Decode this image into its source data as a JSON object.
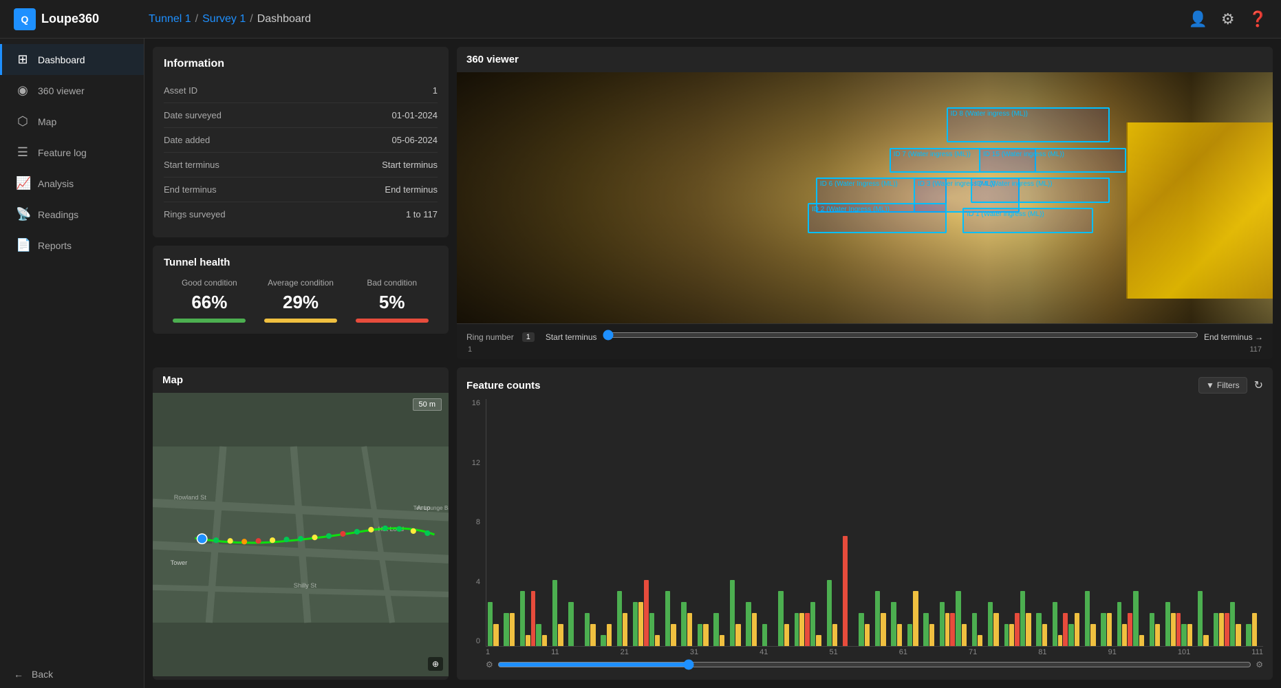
{
  "app": {
    "logo_text": "Loupe360",
    "breadcrumb": {
      "tunnel": "Tunnel 1",
      "survey": "Survey 1",
      "page": "Dashboard"
    }
  },
  "sidebar": {
    "items": [
      {
        "id": "dashboard",
        "label": "Dashboard",
        "icon": "⊞",
        "active": true
      },
      {
        "id": "360viewer",
        "label": "360 viewer",
        "icon": "◉",
        "active": false
      },
      {
        "id": "map",
        "label": "Map",
        "icon": "⬡",
        "active": false
      },
      {
        "id": "featurelog",
        "label": "Feature log",
        "icon": "☰",
        "active": false
      },
      {
        "id": "analysis",
        "label": "Analysis",
        "icon": "📈",
        "active": false
      },
      {
        "id": "readings",
        "label": "Readings",
        "icon": "📡",
        "active": false
      },
      {
        "id": "reports",
        "label": "Reports",
        "icon": "📄",
        "active": false
      }
    ],
    "back_label": "Back"
  },
  "info": {
    "title": "Information",
    "rows": [
      {
        "label": "Asset ID",
        "value": "1"
      },
      {
        "label": "Date surveyed",
        "value": "01-01-2024"
      },
      {
        "label": "Date added",
        "value": "05-06-2024"
      },
      {
        "label": "Start terminus",
        "value": "Start terminus"
      },
      {
        "label": "End terminus",
        "value": "End terminus"
      },
      {
        "label": "Rings surveyed",
        "value": "1 to 117"
      }
    ]
  },
  "tunnel_health": {
    "title": "Tunnel health",
    "metrics": [
      {
        "label": "Good condition",
        "value": "66%",
        "color": "green"
      },
      {
        "label": "Average condition",
        "value": "29%",
        "color": "yellow"
      },
      {
        "label": "Bad condition",
        "value": "5%",
        "color": "red"
      }
    ]
  },
  "viewer": {
    "title": "360 viewer",
    "ring_label": "Ring number",
    "start_label": "Start terminus",
    "end_label": "End terminus →",
    "ring_value": "1",
    "slider_min": "1",
    "slider_max": "117",
    "detections": [
      {
        "label": "ID 8 (Water ingress (ML))",
        "top": "22%",
        "left": "60%",
        "width": "18%",
        "height": "14%"
      },
      {
        "label": "ID 7 (Water ingress (ML))",
        "top": "32%",
        "left": "53%",
        "width": "17%",
        "height": "10%"
      },
      {
        "label": "ID 6 (Water Ingress (ML))",
        "top": "41%",
        "left": "44%",
        "width": "16%",
        "height": "12%"
      },
      {
        "label": "ID 3 (Water ingress (ML))",
        "top": "41%",
        "left": "55%",
        "width": "14%",
        "height": "12%"
      },
      {
        "label": "ID 2 (Water Ingress (ML))",
        "top": "50%",
        "left": "43%",
        "width": "16%",
        "height": "12%"
      },
      {
        "label": "ID 1 (Water ingress (ML))",
        "top": "52%",
        "left": "62%",
        "width": "15%",
        "height": "10%"
      },
      {
        "label": "ID 15 (Water ingress (ML))",
        "top": "33%",
        "left": "63%",
        "width": "17%",
        "height": "10%"
      },
      {
        "label": "ID 4 (Water ingress (ML))",
        "top": "42%",
        "left": "63%",
        "width": "16%",
        "height": "10%"
      }
    ]
  },
  "map": {
    "title": "Map",
    "scale_label": "50 m"
  },
  "feature_counts": {
    "title": "Feature counts",
    "filter_label": "Filters",
    "y_labels": [
      "0",
      "4",
      "8",
      "12",
      "16"
    ],
    "x_labels": [
      "1",
      "11",
      "21",
      "31",
      "41",
      "51",
      "61",
      "71",
      "81",
      "91",
      "101",
      "111"
    ],
    "bars": [
      {
        "g": 40,
        "y": 20,
        "r": 0
      },
      {
        "g": 30,
        "y": 30,
        "r": 0
      },
      {
        "g": 50,
        "y": 10,
        "r": 50
      },
      {
        "g": 20,
        "y": 10,
        "r": 0
      },
      {
        "g": 60,
        "y": 20,
        "r": 0
      },
      {
        "g": 40,
        "y": 0,
        "r": 0
      },
      {
        "g": 30,
        "y": 20,
        "r": 0
      },
      {
        "g": 10,
        "y": 20,
        "r": 0
      },
      {
        "g": 50,
        "y": 30,
        "r": 0
      },
      {
        "g": 40,
        "y": 40,
        "r": 60
      },
      {
        "g": 30,
        "y": 10,
        "r": 0
      },
      {
        "g": 50,
        "y": 20,
        "r": 0
      },
      {
        "g": 40,
        "y": 30,
        "r": 0
      },
      {
        "g": 20,
        "y": 20,
        "r": 0
      },
      {
        "g": 30,
        "y": 10,
        "r": 0
      },
      {
        "g": 60,
        "y": 20,
        "r": 0
      },
      {
        "g": 40,
        "y": 30,
        "r": 0
      },
      {
        "g": 20,
        "y": 0,
        "r": 0
      },
      {
        "g": 50,
        "y": 20,
        "r": 0
      },
      {
        "g": 30,
        "y": 30,
        "r": 30
      },
      {
        "g": 40,
        "y": 10,
        "r": 0
      },
      {
        "g": 60,
        "y": 20,
        "r": 0
      },
      {
        "g": 0,
        "y": 0,
        "r": 100
      },
      {
        "g": 30,
        "y": 20,
        "r": 0
      },
      {
        "g": 50,
        "y": 30,
        "r": 0
      },
      {
        "g": 40,
        "y": 20,
        "r": 0
      },
      {
        "g": 20,
        "y": 50,
        "r": 0
      },
      {
        "g": 30,
        "y": 20,
        "r": 0
      },
      {
        "g": 40,
        "y": 30,
        "r": 30
      },
      {
        "g": 50,
        "y": 20,
        "r": 0
      },
      {
        "g": 30,
        "y": 10,
        "r": 0
      },
      {
        "g": 40,
        "y": 30,
        "r": 0
      },
      {
        "g": 20,
        "y": 20,
        "r": 30
      },
      {
        "g": 50,
        "y": 30,
        "r": 0
      },
      {
        "g": 30,
        "y": 20,
        "r": 0
      },
      {
        "g": 40,
        "y": 10,
        "r": 30
      },
      {
        "g": 20,
        "y": 30,
        "r": 0
      },
      {
        "g": 50,
        "y": 20,
        "r": 0
      },
      {
        "g": 30,
        "y": 30,
        "r": 0
      },
      {
        "g": 40,
        "y": 20,
        "r": 30
      },
      {
        "g": 50,
        "y": 10,
        "r": 0
      },
      {
        "g": 30,
        "y": 20,
        "r": 0
      },
      {
        "g": 40,
        "y": 30,
        "r": 30
      },
      {
        "g": 20,
        "y": 20,
        "r": 0
      },
      {
        "g": 50,
        "y": 10,
        "r": 0
      },
      {
        "g": 30,
        "y": 30,
        "r": 30
      },
      {
        "g": 40,
        "y": 20,
        "r": 0
      },
      {
        "g": 20,
        "y": 30,
        "r": 0
      }
    ]
  }
}
